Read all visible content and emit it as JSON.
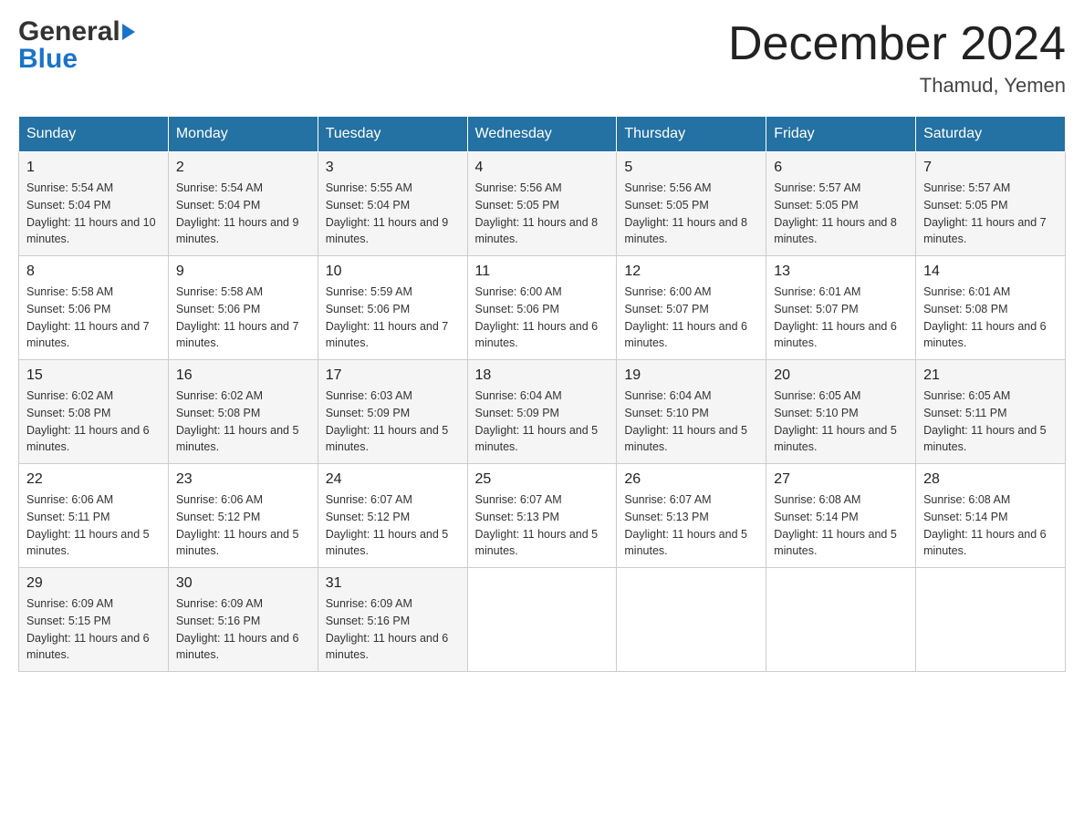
{
  "header": {
    "logo_line1": "General",
    "logo_line2": "Blue",
    "month_title": "December 2024",
    "location": "Thamud, Yemen"
  },
  "days_of_week": [
    "Sunday",
    "Monday",
    "Tuesday",
    "Wednesday",
    "Thursday",
    "Friday",
    "Saturday"
  ],
  "weeks": [
    [
      {
        "day": "1",
        "sunrise": "5:54 AM",
        "sunset": "5:04 PM",
        "daylight": "11 hours and 10 minutes."
      },
      {
        "day": "2",
        "sunrise": "5:54 AM",
        "sunset": "5:04 PM",
        "daylight": "11 hours and 9 minutes."
      },
      {
        "day": "3",
        "sunrise": "5:55 AM",
        "sunset": "5:04 PM",
        "daylight": "11 hours and 9 minutes."
      },
      {
        "day": "4",
        "sunrise": "5:56 AM",
        "sunset": "5:05 PM",
        "daylight": "11 hours and 8 minutes."
      },
      {
        "day": "5",
        "sunrise": "5:56 AM",
        "sunset": "5:05 PM",
        "daylight": "11 hours and 8 minutes."
      },
      {
        "day": "6",
        "sunrise": "5:57 AM",
        "sunset": "5:05 PM",
        "daylight": "11 hours and 8 minutes."
      },
      {
        "day": "7",
        "sunrise": "5:57 AM",
        "sunset": "5:05 PM",
        "daylight": "11 hours and 7 minutes."
      }
    ],
    [
      {
        "day": "8",
        "sunrise": "5:58 AM",
        "sunset": "5:06 PM",
        "daylight": "11 hours and 7 minutes."
      },
      {
        "day": "9",
        "sunrise": "5:58 AM",
        "sunset": "5:06 PM",
        "daylight": "11 hours and 7 minutes."
      },
      {
        "day": "10",
        "sunrise": "5:59 AM",
        "sunset": "5:06 PM",
        "daylight": "11 hours and 7 minutes."
      },
      {
        "day": "11",
        "sunrise": "6:00 AM",
        "sunset": "5:06 PM",
        "daylight": "11 hours and 6 minutes."
      },
      {
        "day": "12",
        "sunrise": "6:00 AM",
        "sunset": "5:07 PM",
        "daylight": "11 hours and 6 minutes."
      },
      {
        "day": "13",
        "sunrise": "6:01 AM",
        "sunset": "5:07 PM",
        "daylight": "11 hours and 6 minutes."
      },
      {
        "day": "14",
        "sunrise": "6:01 AM",
        "sunset": "5:08 PM",
        "daylight": "11 hours and 6 minutes."
      }
    ],
    [
      {
        "day": "15",
        "sunrise": "6:02 AM",
        "sunset": "5:08 PM",
        "daylight": "11 hours and 6 minutes."
      },
      {
        "day": "16",
        "sunrise": "6:02 AM",
        "sunset": "5:08 PM",
        "daylight": "11 hours and 5 minutes."
      },
      {
        "day": "17",
        "sunrise": "6:03 AM",
        "sunset": "5:09 PM",
        "daylight": "11 hours and 5 minutes."
      },
      {
        "day": "18",
        "sunrise": "6:04 AM",
        "sunset": "5:09 PM",
        "daylight": "11 hours and 5 minutes."
      },
      {
        "day": "19",
        "sunrise": "6:04 AM",
        "sunset": "5:10 PM",
        "daylight": "11 hours and 5 minutes."
      },
      {
        "day": "20",
        "sunrise": "6:05 AM",
        "sunset": "5:10 PM",
        "daylight": "11 hours and 5 minutes."
      },
      {
        "day": "21",
        "sunrise": "6:05 AM",
        "sunset": "5:11 PM",
        "daylight": "11 hours and 5 minutes."
      }
    ],
    [
      {
        "day": "22",
        "sunrise": "6:06 AM",
        "sunset": "5:11 PM",
        "daylight": "11 hours and 5 minutes."
      },
      {
        "day": "23",
        "sunrise": "6:06 AM",
        "sunset": "5:12 PM",
        "daylight": "11 hours and 5 minutes."
      },
      {
        "day": "24",
        "sunrise": "6:07 AM",
        "sunset": "5:12 PM",
        "daylight": "11 hours and 5 minutes."
      },
      {
        "day": "25",
        "sunrise": "6:07 AM",
        "sunset": "5:13 PM",
        "daylight": "11 hours and 5 minutes."
      },
      {
        "day": "26",
        "sunrise": "6:07 AM",
        "sunset": "5:13 PM",
        "daylight": "11 hours and 5 minutes."
      },
      {
        "day": "27",
        "sunrise": "6:08 AM",
        "sunset": "5:14 PM",
        "daylight": "11 hours and 5 minutes."
      },
      {
        "day": "28",
        "sunrise": "6:08 AM",
        "sunset": "5:14 PM",
        "daylight": "11 hours and 6 minutes."
      }
    ],
    [
      {
        "day": "29",
        "sunrise": "6:09 AM",
        "sunset": "5:15 PM",
        "daylight": "11 hours and 6 minutes."
      },
      {
        "day": "30",
        "sunrise": "6:09 AM",
        "sunset": "5:16 PM",
        "daylight": "11 hours and 6 minutes."
      },
      {
        "day": "31",
        "sunrise": "6:09 AM",
        "sunset": "5:16 PM",
        "daylight": "11 hours and 6 minutes."
      },
      null,
      null,
      null,
      null
    ]
  ]
}
